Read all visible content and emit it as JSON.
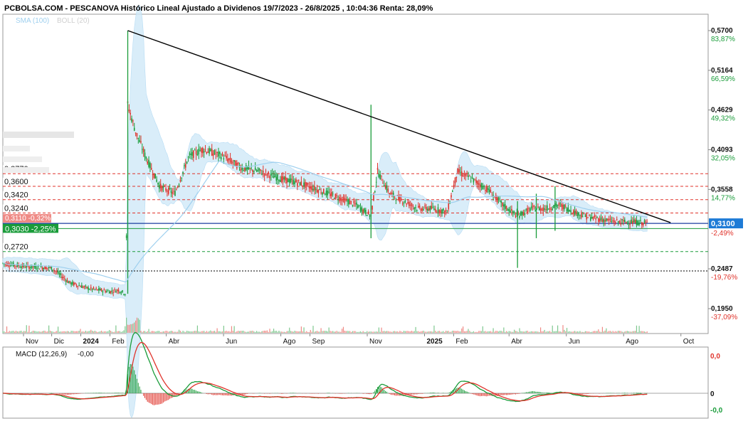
{
  "header": {
    "title": "PCBOLSA.COM - PESCANOVA Histórico Lineal Ajustado a Dividenos 19/7/2023 - 26/8/2025 , 10:04:36 Renta: 28,09%",
    "indicators": [
      "SMA (100)",
      "BOLL (20)"
    ]
  },
  "chart_data": {
    "type": "candlestick",
    "x_ticks": [
      "Nov",
      "Dic",
      "2024",
      "Feb",
      "Abr",
      "Jun",
      "Ago",
      "Sep",
      "Nov",
      "2025",
      "Feb",
      "Abr",
      "Jun",
      "Ago",
      "Oct"
    ],
    "y_ticks": [
      {
        "value": "0,5700",
        "pct": "83,87%",
        "dir": "up"
      },
      {
        "value": "0,5164",
        "pct": "66,59%",
        "dir": "up"
      },
      {
        "value": "0,4629",
        "pct": "49,32%",
        "dir": "up"
      },
      {
        "value": "0,4093",
        "pct": "32,05%",
        "dir": "up"
      },
      {
        "value": "0,3558",
        "pct": "14,77%",
        "dir": "up"
      },
      {
        "value": "0,2487",
        "pct": "-19,76%",
        "dir": "down"
      },
      {
        "value": "0,1950",
        "pct": "-37,09%",
        "dir": "down"
      }
    ],
    "last_price": "0,3100",
    "last_change": "-2,49%",
    "levels": [
      {
        "label": "0,3770",
        "value": 0.377,
        "style": "red-dashed"
      },
      {
        "label": "0,3600",
        "value": 0.36,
        "style": "red-dashed"
      },
      {
        "label": "0,3420",
        "value": 0.342,
        "style": "red-dashed"
      },
      {
        "label": "0,3240",
        "value": 0.324,
        "style": "red-dashed"
      },
      {
        "label": "0,3030 -2,25%",
        "value": 0.303,
        "style": "green-solid"
      },
      {
        "label": "0,2720",
        "value": 0.272,
        "style": "green-dashed"
      }
    ],
    "hidden_level_label": "0,3110 -0,32%",
    "trendline": {
      "from": [
        "2024-02-20",
        0.57
      ],
      "to": [
        "2025-09-20",
        0.311
      ]
    },
    "price_path": [
      [
        "2023-10-01",
        0.258
      ],
      [
        "2023-11-01",
        0.252
      ],
      [
        "2023-12-01",
        0.25
      ],
      [
        "2023-12-20",
        0.23
      ],
      [
        "2024-01-10",
        0.222
      ],
      [
        "2024-02-01",
        0.218
      ],
      [
        "2024-02-10",
        0.22
      ],
      [
        "2024-02-18",
        0.215
      ],
      [
        "2024-02-20",
        0.47
      ],
      [
        "2024-02-28",
        0.435
      ],
      [
        "2024-03-10",
        0.4
      ],
      [
        "2024-03-25",
        0.36
      ],
      [
        "2024-04-10",
        0.35
      ],
      [
        "2024-04-25",
        0.4
      ],
      [
        "2024-05-10",
        0.41
      ],
      [
        "2024-06-01",
        0.4
      ],
      [
        "2024-06-20",
        0.385
      ],
      [
        "2024-07-10",
        0.38
      ],
      [
        "2024-08-01",
        0.37
      ],
      [
        "2024-08-20",
        0.365
      ],
      [
        "2024-09-10",
        0.355
      ],
      [
        "2024-10-01",
        0.345
      ],
      [
        "2024-10-20",
        0.335
      ],
      [
        "2024-11-05",
        0.32
      ],
      [
        "2024-11-12",
        0.38
      ],
      [
        "2024-11-25",
        0.35
      ],
      [
        "2024-12-10",
        0.34
      ],
      [
        "2024-12-25",
        0.33
      ],
      [
        "2025-01-10",
        0.33
      ],
      [
        "2025-01-25",
        0.325
      ],
      [
        "2025-02-05",
        0.38
      ],
      [
        "2025-02-20",
        0.37
      ],
      [
        "2025-03-10",
        0.355
      ],
      [
        "2025-03-25",
        0.335
      ],
      [
        "2025-04-10",
        0.32
      ],
      [
        "2025-04-25",
        0.33
      ],
      [
        "2025-05-10",
        0.33
      ],
      [
        "2025-05-25",
        0.335
      ],
      [
        "2025-06-10",
        0.325
      ],
      [
        "2025-06-25",
        0.318
      ],
      [
        "2025-07-10",
        0.315
      ],
      [
        "2025-07-25",
        0.312
      ],
      [
        "2025-08-10",
        0.312
      ],
      [
        "2025-08-26",
        0.31
      ]
    ],
    "macd": {
      "label": "MACD (12,26,9)",
      "value": "-0,00",
      "y_ticks": [
        "0,0",
        "0",
        "-0,0"
      ]
    }
  },
  "colors": {
    "up": "#1a9c3a",
    "down": "#e0332b",
    "band": "#cfe8f8",
    "sma": "#9fd0ef",
    "trend": "#000000",
    "last": "#1e7bd6"
  }
}
